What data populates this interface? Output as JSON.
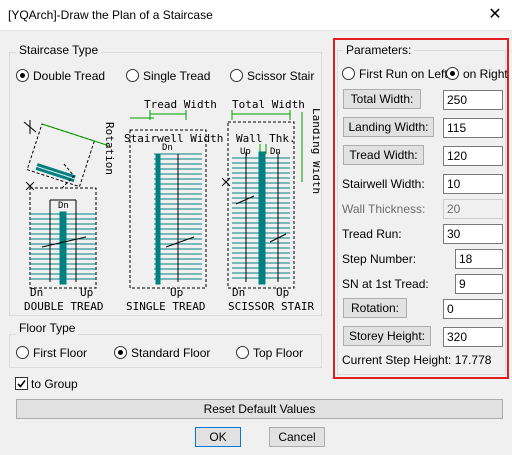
{
  "window": {
    "title": "[YQArch]-Draw the Plan of a Staircase"
  },
  "staircase_type": {
    "label": "Staircase Type",
    "options": [
      {
        "label": "Double Tread",
        "checked": true
      },
      {
        "label": "Single Tread",
        "checked": false
      },
      {
        "label": "Scissor Stair",
        "checked": false
      }
    ]
  },
  "diagram": {
    "rotation": "Rotation",
    "tread_width": "Tread Width",
    "total_width": "Total Width",
    "stairwell_width": "Stairwell Width",
    "wall_thk": "Wall Thk.",
    "landing_width": "Landing Width",
    "dn": "Dn",
    "up": "Up",
    "caption_double": "DOUBLE TREAD",
    "caption_single": "SINGLE TREAD",
    "caption_scissor": "SCISSOR STAIR"
  },
  "floor_type": {
    "label": "Floor Type",
    "options": [
      {
        "label": "First Floor",
        "checked": false
      },
      {
        "label": "Standard Floor",
        "checked": true
      },
      {
        "label": "Top Floor",
        "checked": false
      }
    ]
  },
  "to_group": {
    "label": "to Group",
    "checked": true
  },
  "reset_button": "Reset Default Values",
  "ok_button": "OK",
  "cancel_button": "Cancel",
  "parameters": {
    "label": "Parameters:",
    "first_run": [
      {
        "label": "First Run on Left",
        "checked": false
      },
      {
        "label": "on Right",
        "checked": true
      }
    ],
    "total_width": {
      "label": "Total Width:",
      "value": "250"
    },
    "landing_width": {
      "label": "Landing Width:",
      "value": "115"
    },
    "tread_width": {
      "label": "Tread Width:",
      "value": "120"
    },
    "stairwell_width": {
      "label": "Stairwell Width:",
      "value": "10"
    },
    "wall_thickness": {
      "label": "Wall Thickness:",
      "value": "20"
    },
    "tread_run": {
      "label": "Tread Run:",
      "value": "30"
    },
    "step_number": {
      "label": "Step Number:",
      "value": "18"
    },
    "sn_first_tread": {
      "label": "SN at 1st Tread:",
      "value": "9"
    },
    "rotation": {
      "label": "Rotation:",
      "value": "0"
    },
    "storey_height": {
      "label": "Storey Height:",
      "value": "320"
    },
    "current_step_height": "Current Step Height: 17.778"
  },
  "colors": {
    "highlight": "#e02020",
    "stair": "#008080",
    "dim": "#00a000"
  }
}
